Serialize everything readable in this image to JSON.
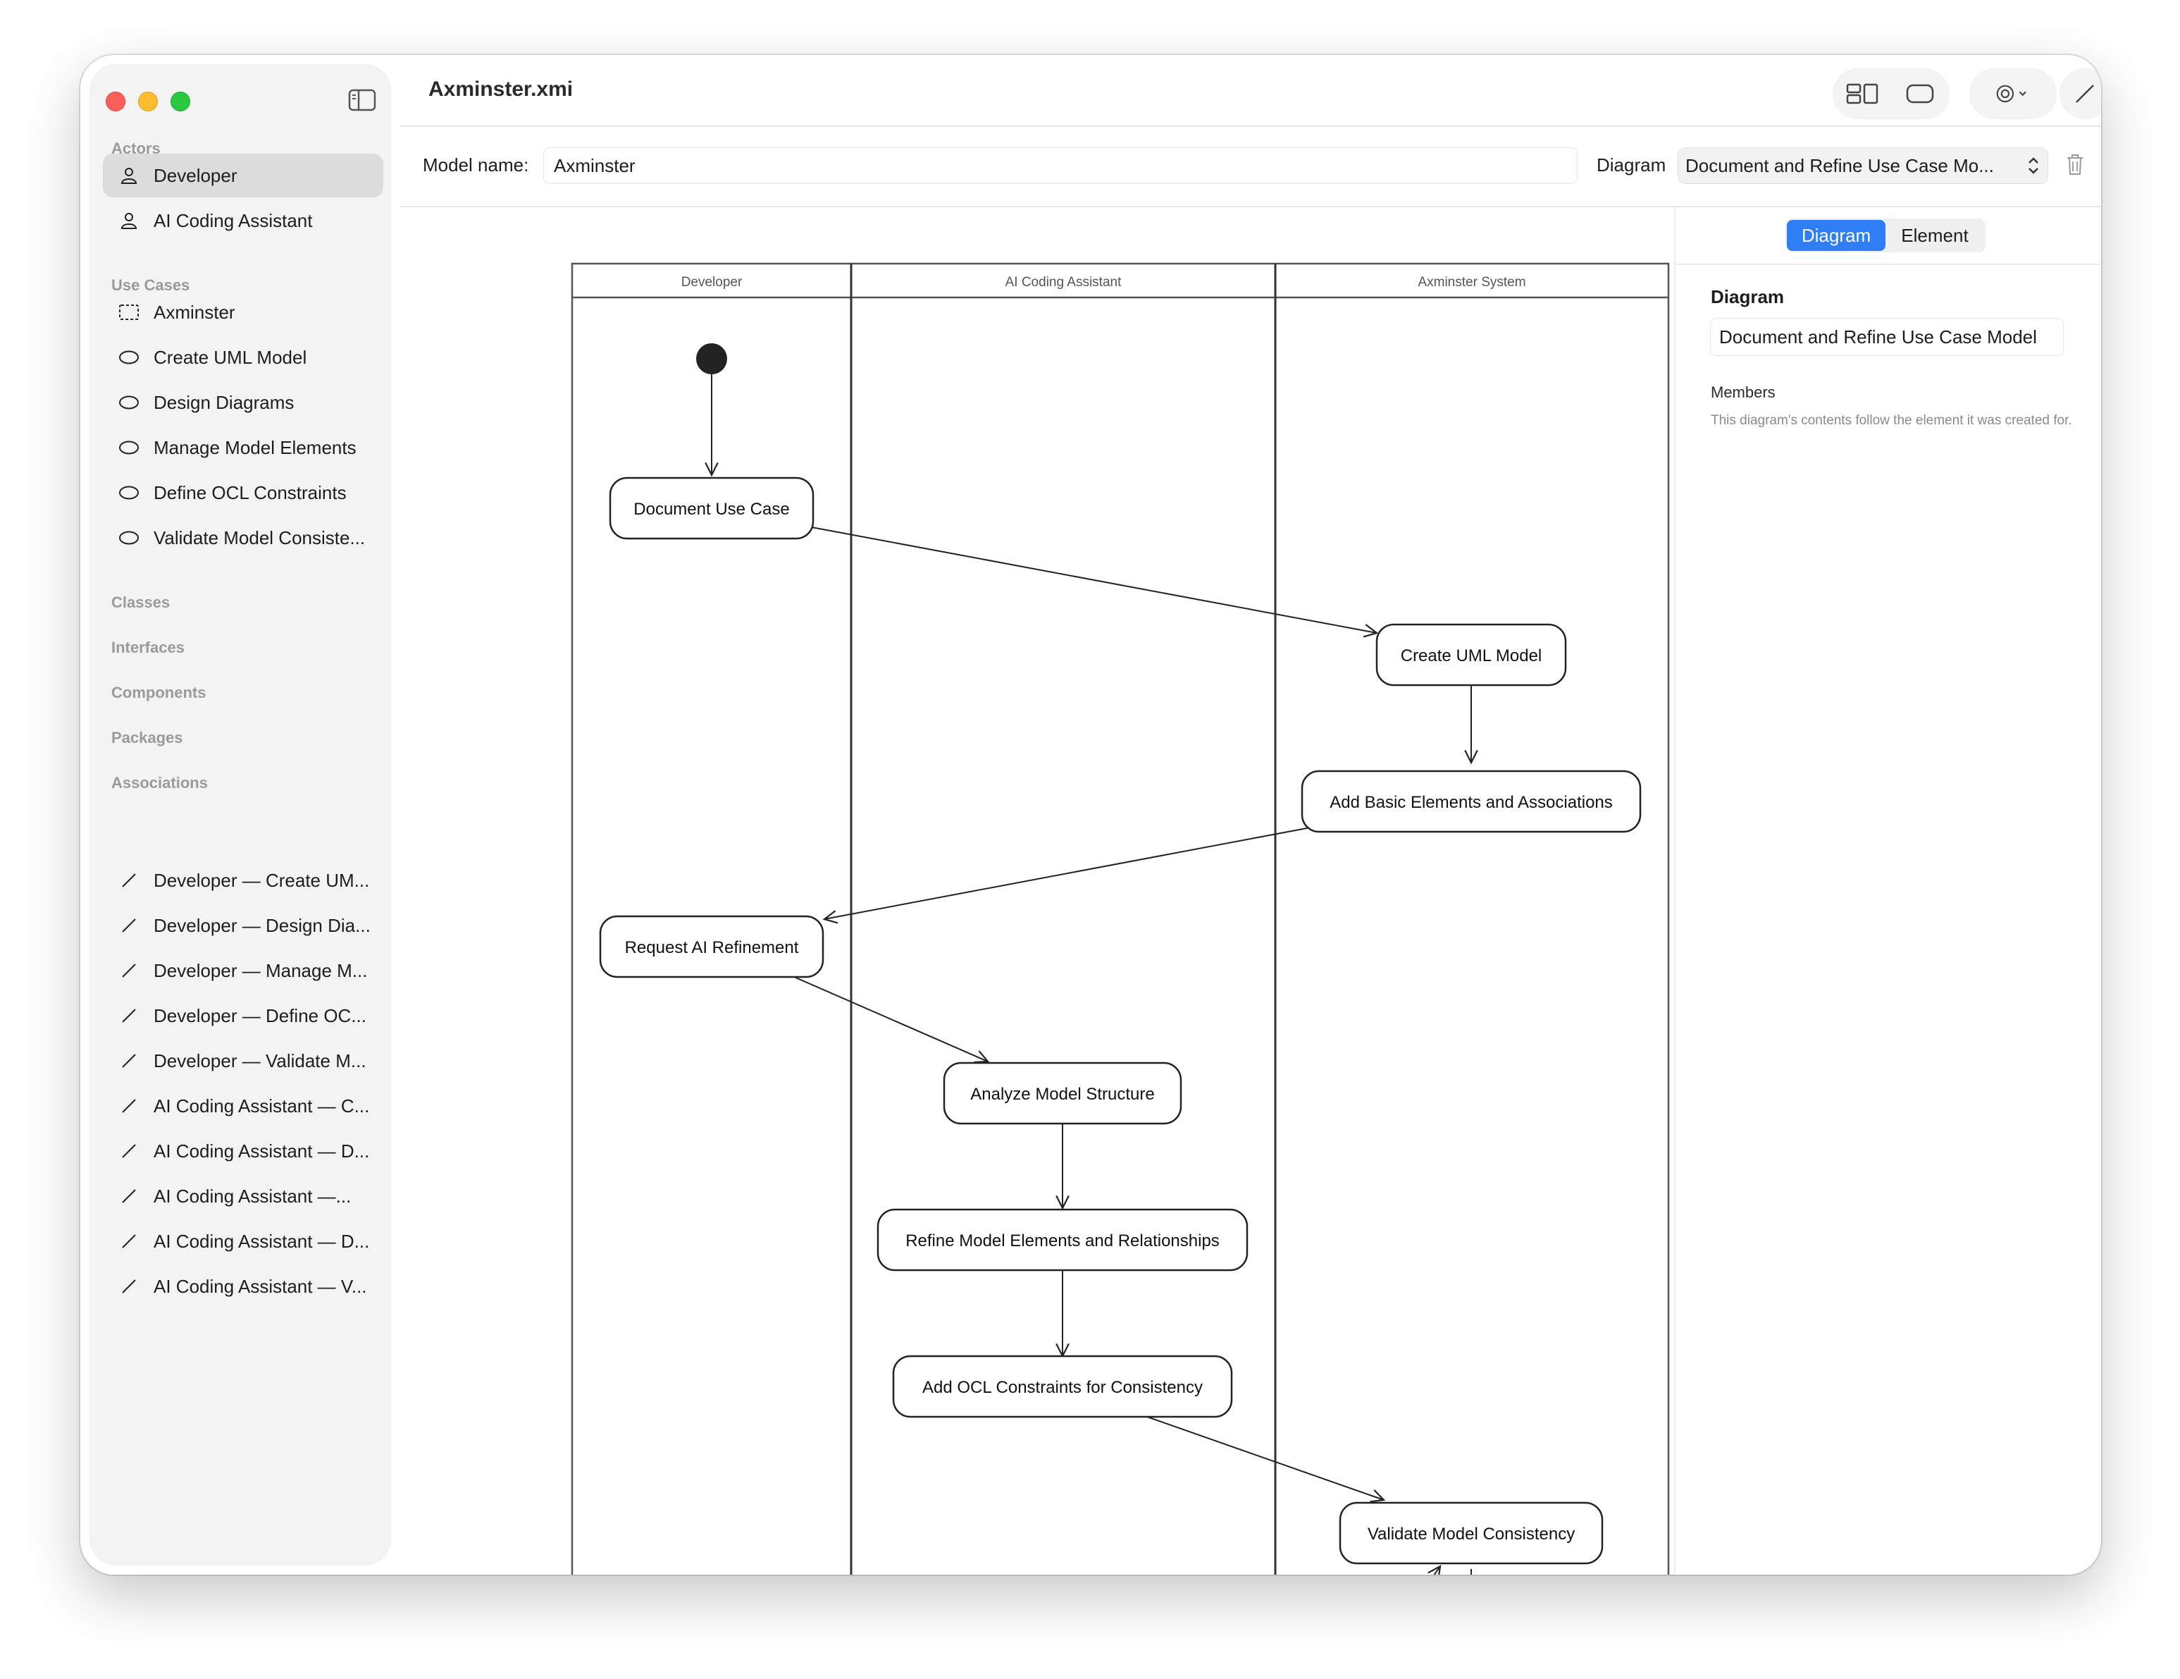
{
  "window": {
    "title": "Axminster.xmi"
  },
  "sidebar": {
    "sections": {
      "actors": "Actors",
      "use_cases": "Use Cases",
      "classes": "Classes",
      "interfaces": "Interfaces",
      "components": "Components",
      "packages": "Packages",
      "associations": "Associations"
    },
    "actors": [
      "Developer",
      "AI Coding Assistant"
    ],
    "use_cases": [
      "Axminster",
      "Create UML Model",
      "Design Diagrams",
      "Manage Model Elements",
      "Define OCL Constraints",
      "Validate Model Consiste..."
    ],
    "associations": [
      "Developer — Create UM...",
      "Developer — Design Dia...",
      "Developer — Manage M...",
      "Developer — Define OC...",
      "Developer — Validate M...",
      "AI Coding Assistant — C...",
      "AI Coding Assistant — D...",
      "AI Coding Assistant —...",
      "AI Coding Assistant — D...",
      "AI Coding Assistant — V..."
    ],
    "selected": "Developer"
  },
  "toolbar": {
    "model_name_label": "Model name:",
    "model_name_value": "Axminster",
    "diagram_label": "Diagram",
    "diagram_select": "Document and Refine Use Case Mo..."
  },
  "diagram": {
    "lanes": [
      "Developer",
      "AI Coding Assistant",
      "Axminster System"
    ],
    "nodes": [
      "Document Use Case",
      "Create UML Model",
      "Add Basic Elements and Associations",
      "Request AI Refinement",
      "Analyze Model Structure",
      "Refine Model Elements and Relationships",
      "Add OCL Constraints for Consistency",
      "Validate Model Consistency"
    ]
  },
  "inspector": {
    "tabs": [
      "Diagram",
      "Element"
    ],
    "active_tab": "Diagram",
    "heading": "Diagram",
    "diagram_name": "Document and Refine Use Case Model",
    "members_label": "Members",
    "members_note": "This diagram's contents follow the element it was created for."
  },
  "colors": {
    "accent": "#2f7ef5",
    "sidebar_bg": "#f3f3f3",
    "selected_bg": "#dcdcdc"
  }
}
